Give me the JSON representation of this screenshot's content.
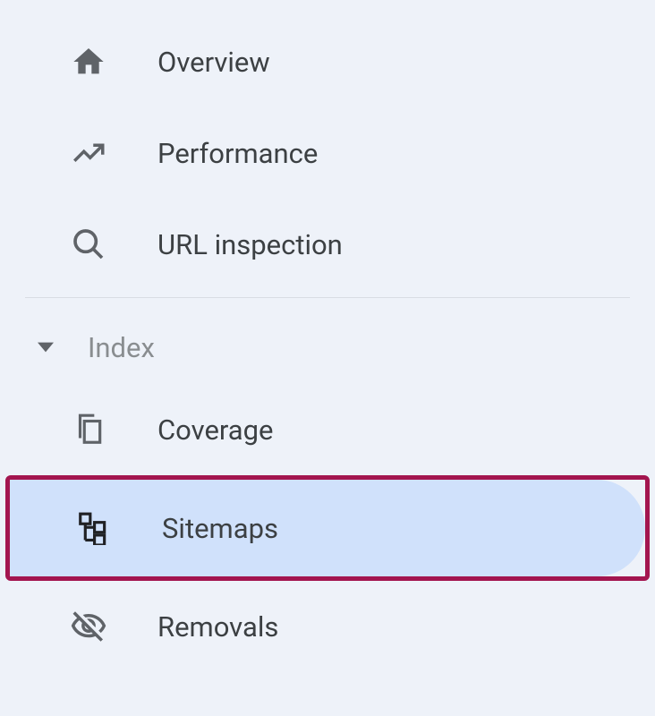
{
  "sidebar": {
    "items": [
      {
        "label": "Overview"
      },
      {
        "label": "Performance"
      },
      {
        "label": "URL inspection"
      }
    ],
    "section": {
      "label": "Index",
      "items": [
        {
          "label": "Coverage"
        },
        {
          "label": "Sitemaps"
        },
        {
          "label": "Removals"
        }
      ]
    }
  }
}
